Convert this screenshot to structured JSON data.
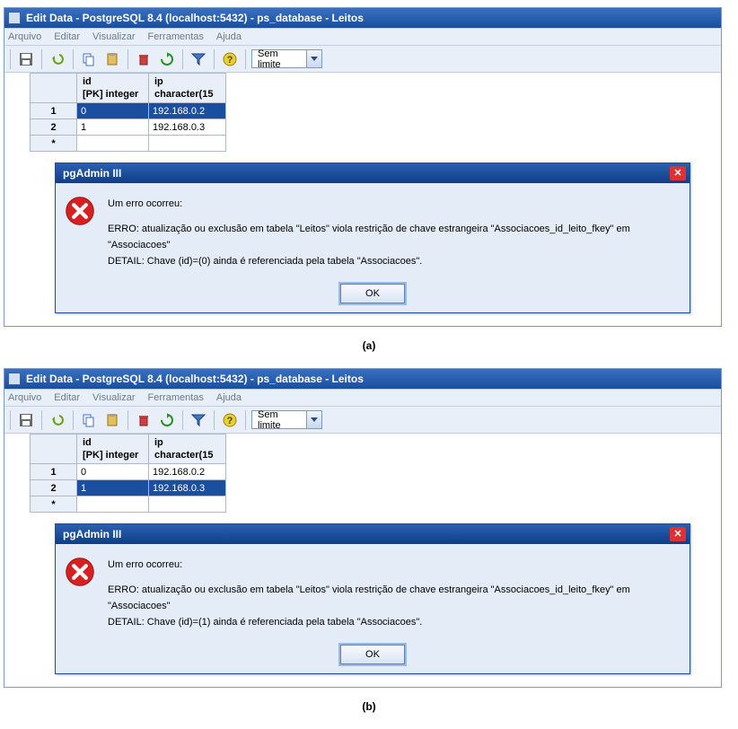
{
  "windows": [
    {
      "title": "Edit Data - PostgreSQL 8.4 (localhost:5432) - ps_database - Leitos",
      "menu": [
        "Arquivo",
        "Editar",
        "Visualizar",
        "Ferramentas",
        "Ajuda"
      ],
      "limit_combo": "Sem limite",
      "grid": {
        "columns": [
          {
            "name": "id",
            "type": "[PK] integer",
            "w": 80
          },
          {
            "name": "ip",
            "type": "character(15",
            "w": 86
          }
        ],
        "rows": [
          {
            "n": "1",
            "cells": [
              "0",
              "192.168.0.2"
            ],
            "sel": [
              true,
              true
            ]
          },
          {
            "n": "2",
            "cells": [
              "1",
              "192.168.0.3"
            ],
            "sel": [
              false,
              false
            ]
          },
          {
            "n": "*",
            "cells": [
              "",
              ""
            ],
            "sel": [
              false,
              false
            ]
          }
        ]
      },
      "dialog": {
        "title": "pgAdmin III",
        "heading": "Um erro ocorreu:",
        "line1": "ERRO:  atualização ou exclusão em tabela \"Leitos\" viola restrição de chave estrangeira \"Associacoes_id_leito_fkey\" em \"Associacoes\"",
        "line2": "DETAIL:  Chave (id)=(0) ainda é referenciada pela tabela \"Associacoes\".",
        "ok": "OK"
      },
      "caption": "(a)"
    },
    {
      "title": "Edit Data - PostgreSQL 8.4 (localhost:5432) - ps_database - Leitos",
      "menu": [
        "Arquivo",
        "Editar",
        "Visualizar",
        "Ferramentas",
        "Ajuda"
      ],
      "limit_combo": "Sem limite",
      "grid": {
        "columns": [
          {
            "name": "id",
            "type": "[PK] integer",
            "w": 80
          },
          {
            "name": "ip",
            "type": "character(15",
            "w": 86
          }
        ],
        "rows": [
          {
            "n": "1",
            "cells": [
              "0",
              "192.168.0.2"
            ],
            "sel": [
              false,
              false
            ]
          },
          {
            "n": "2",
            "cells": [
              "1",
              "192.168.0.3"
            ],
            "sel": [
              true,
              true
            ]
          },
          {
            "n": "*",
            "cells": [
              "",
              ""
            ],
            "sel": [
              false,
              false
            ]
          }
        ]
      },
      "dialog": {
        "title": "pgAdmin III",
        "heading": "Um erro ocorreu:",
        "line1": "ERRO:  atualização ou exclusão em tabela \"Leitos\" viola restrição de chave estrangeira \"Associacoes_id_leito_fkey\" em \"Associacoes\"",
        "line2": "DETAIL:  Chave (id)=(1) ainda é referenciada pela tabela \"Associacoes\".",
        "ok": "OK"
      },
      "caption": "(b)"
    }
  ],
  "icons": {
    "toolbar": [
      "save",
      "undo",
      "copy",
      "paste",
      "delete",
      "refresh",
      "filter",
      "help"
    ]
  }
}
